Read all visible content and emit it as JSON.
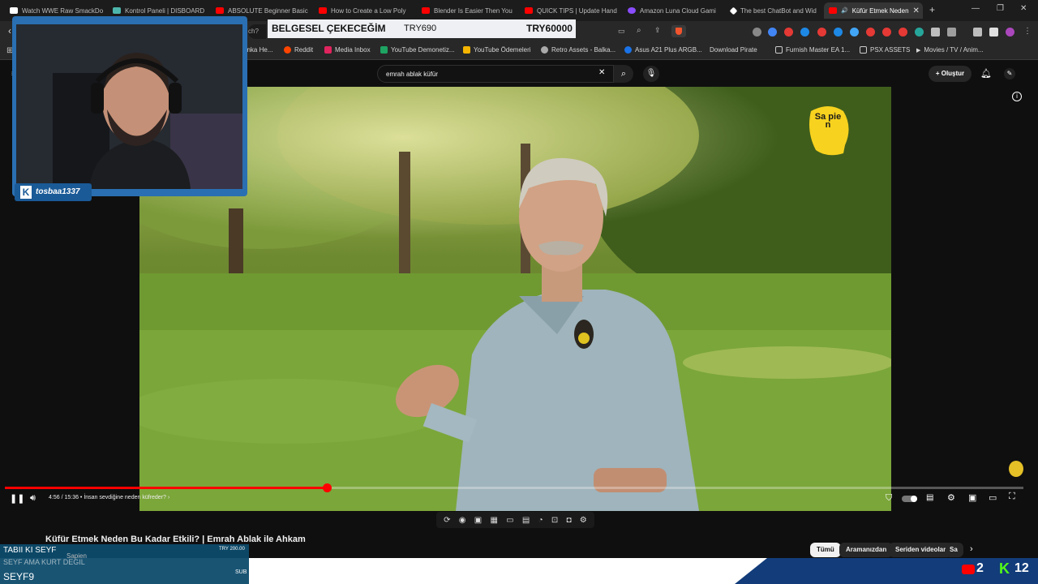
{
  "tabs": [
    {
      "label": "Watch WWE Raw SmackDo",
      "color": "#ffffff"
    },
    {
      "label": "Kontrol Paneli | DISBOARD",
      "color": "#4db6ac"
    },
    {
      "label": "ABSOLUTE Beginner Basic",
      "color": "#ff0000"
    },
    {
      "label": "How to Create a Low Poly",
      "color": "#ff0000"
    },
    {
      "label": "Blender Is Easier Then You",
      "color": "#ff0000"
    },
    {
      "label": "QUICK TIPS | Update Hand",
      "color": "#ff0000"
    },
    {
      "label": "Amazon Luna Cloud Gami",
      "color": "#8a4dff"
    },
    {
      "label": "The best ChatBot and Wid",
      "color": "#ffffff"
    },
    {
      "label": "Küfür Etmek Neden",
      "color": "#ff0000"
    }
  ],
  "address": {
    "url_fragment": "ch?v=M"
  },
  "overlay": {
    "label": "BELGESEL ÇEKECEĞİM",
    "value_a": "TRY690",
    "value_b": "TRY60000"
  },
  "bookmarks": [
    {
      "label": "anka He...",
      "color": "#888888"
    },
    {
      "label": "Reddit",
      "color": "#ff4500"
    },
    {
      "label": "Media Inbox",
      "color": "#e0245e"
    },
    {
      "label": "YouTube Demonetiz...",
      "color": "#1ea362"
    },
    {
      "label": "YouTube Ödemeleri",
      "color": "#f4b400"
    },
    {
      "label": "Retro Assets - Balka...",
      "color": "#aaaaaa"
    },
    {
      "label": "Asus A21 Plus ARGB...",
      "color": "#1a73e8"
    },
    {
      "label": "Download Pirate",
      "color": "#888888"
    },
    {
      "label": "Furnish Master EA 1...",
      "color": "#cccccc"
    },
    {
      "label": "PSX ASSETS",
      "color": "#cccccc"
    },
    {
      "label": "Movies / TV / Anim...",
      "color": "#cccccc"
    }
  ],
  "search": {
    "query": "emrah ablak küfür"
  },
  "header": {
    "create_label": "Oluştur"
  },
  "webcam": {
    "username": "tosbaa1337"
  },
  "player": {
    "time": "4:56 / 15:36",
    "chapter": "İnsan sevdiğine neden küfreder?",
    "progress": 0.316,
    "channel_logo": "Sa pie n"
  },
  "video": {
    "title": "Küfür Etmek Neden Bu Kadar Etkili? | Emrah Ablak ile Ahkam"
  },
  "chips": [
    "Tümü",
    "Aramanızdan",
    "Seriden videolar",
    "Sa"
  ],
  "stream": {
    "donor_line1": "TABII KI SEYF",
    "donor_line2": "SEYF AMA KURT DEGIL",
    "donor_amount": "TRY 200.00",
    "sub_name": "SEYF9",
    "sub_label": "SUB",
    "youtube_count": "2",
    "kick_count": "12",
    "channel_row": "Sapien"
  }
}
